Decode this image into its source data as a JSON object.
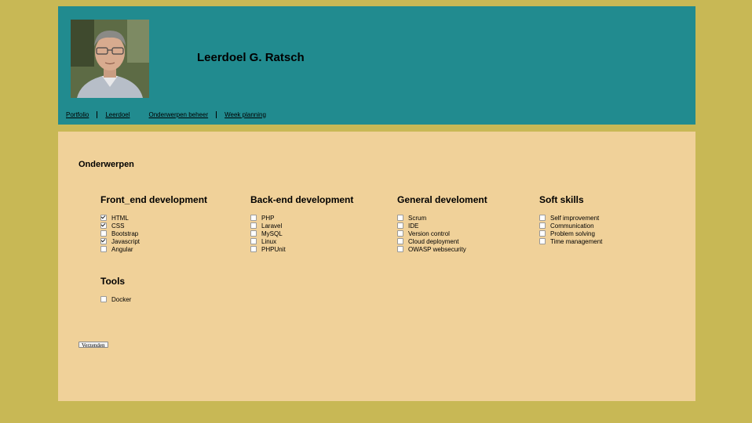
{
  "header": {
    "title": "Leerdoel G. Ratsch",
    "nav": [
      {
        "label": "Portfolio"
      },
      {
        "label": "Leerdoel"
      },
      {
        "label": "Onderwerpen beheer"
      },
      {
        "label": "Week planning"
      }
    ]
  },
  "main": {
    "heading": "Onderwerpen",
    "groups": [
      {
        "title": "Front_end development",
        "options": [
          {
            "label": "HTML",
            "checked": true
          },
          {
            "label": "CSS",
            "checked": true
          },
          {
            "label": "Bootstrap",
            "checked": false
          },
          {
            "label": "Javascript",
            "checked": true
          },
          {
            "label": "Angular",
            "checked": false
          }
        ]
      },
      {
        "title": "Back-end development",
        "options": [
          {
            "label": "PHP",
            "checked": false
          },
          {
            "label": "Laravel",
            "checked": false
          },
          {
            "label": "MySQL",
            "checked": false
          },
          {
            "label": "Linux",
            "checked": false
          },
          {
            "label": "PHPUnit",
            "checked": false
          }
        ]
      },
      {
        "title": "General develoment",
        "options": [
          {
            "label": "Scrum",
            "checked": false
          },
          {
            "label": "IDE",
            "checked": false
          },
          {
            "label": "Version control",
            "checked": false
          },
          {
            "label": "Cloud deployment",
            "checked": false
          },
          {
            "label": "OWASP websecurity",
            "checked": false
          }
        ]
      },
      {
        "title": "Soft skills",
        "options": [
          {
            "label": "Self improvement",
            "checked": false
          },
          {
            "label": "Communication",
            "checked": false
          },
          {
            "label": "Problem solving",
            "checked": false
          },
          {
            "label": "Time management",
            "checked": false
          }
        ]
      },
      {
        "title": "Tools",
        "options": [
          {
            "label": "Docker",
            "checked": false
          }
        ]
      }
    ],
    "submit_label": "Verzenden"
  },
  "colors": {
    "page_background": "#c8b855",
    "header_background": "#218b8f",
    "content_background": "#f0d199"
  }
}
